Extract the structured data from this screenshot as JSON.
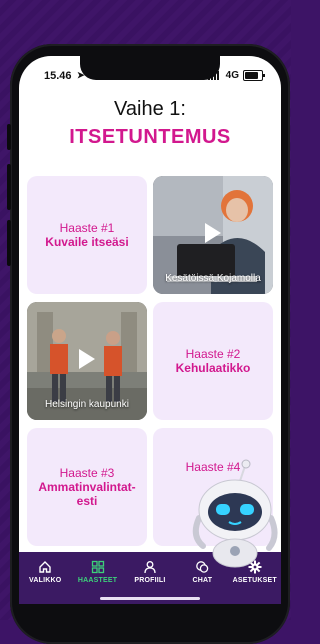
{
  "status_bar": {
    "time": "15.46",
    "network": "4G"
  },
  "header": {
    "step": "Vaihe 1:",
    "title": "ITSETUNTEMUS"
  },
  "cards": [
    {
      "type": "challenge",
      "number": "Haaste #1",
      "title": "Kuvaile itseäsi"
    },
    {
      "type": "video",
      "caption": "Kesätöissä Kojamolla"
    },
    {
      "type": "video",
      "caption": "Helsingin kaupunki"
    },
    {
      "type": "challenge",
      "number": "Haaste #2",
      "title": "Kehulaatikko"
    },
    {
      "type": "challenge",
      "number": "Haaste #3",
      "title": "Ammatinvalintat-esti"
    },
    {
      "type": "challenge",
      "number": "Haaste #4",
      "title": ""
    }
  ],
  "tabs": [
    {
      "label": "VALIKKO",
      "icon": "home-icon"
    },
    {
      "label": "HAASTEET",
      "icon": "grid-icon",
      "active": true
    },
    {
      "label": "PROFIILI",
      "icon": "user-icon"
    },
    {
      "label": "CHAT",
      "icon": "chat-icon"
    },
    {
      "label": "ASETUKSET",
      "icon": "gear-icon"
    }
  ],
  "colors": {
    "accent": "#d2188e",
    "tabbar": "#3b1a63",
    "active_tab": "#3cd27a",
    "card_bg": "#f3e9fb"
  }
}
